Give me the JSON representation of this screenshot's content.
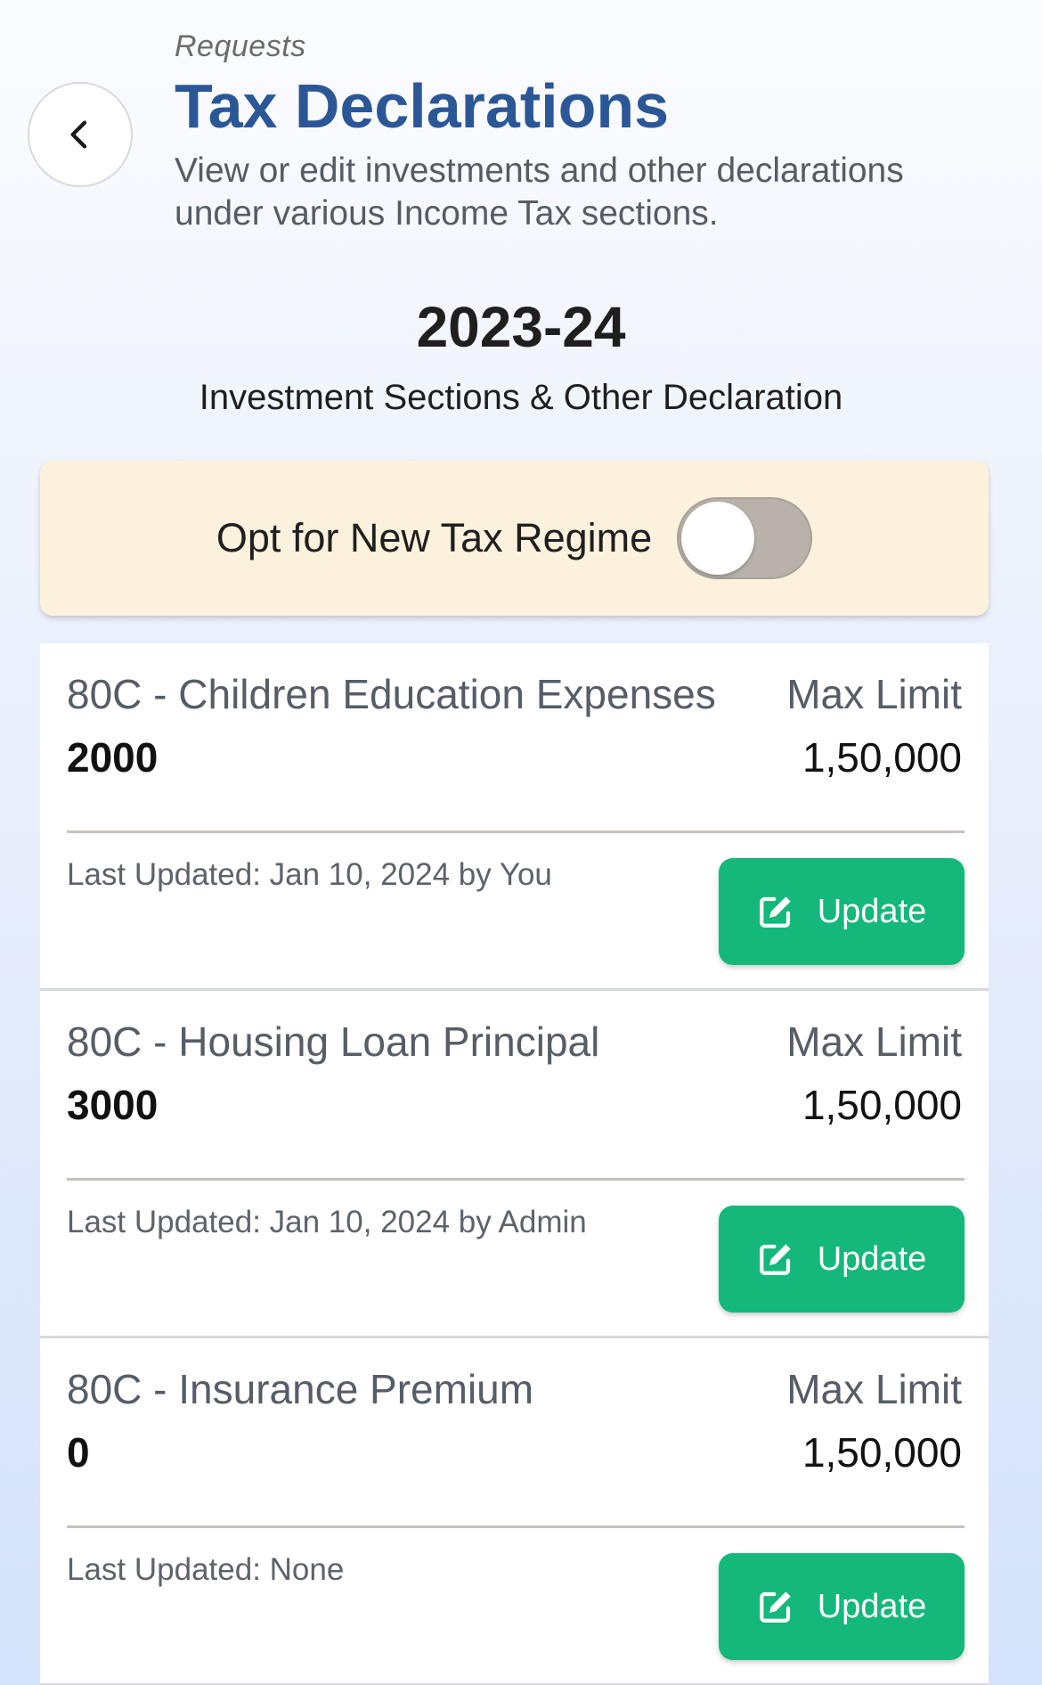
{
  "header": {
    "breadcrumb": "Requests",
    "title": "Tax Declarations",
    "subtitle": "View or edit investments and other declarations under various Income Tax sections."
  },
  "year": {
    "label": "2023-24",
    "subtitle": "Investment Sections & Other Declaration"
  },
  "regime": {
    "label": "Opt for New Tax Regime",
    "enabled": false
  },
  "sections": [
    {
      "title": "80C - Children Education Expenses",
      "value": "2000",
      "limit_label": "Max Limit",
      "limit_value": "1,50,000",
      "updated": "Last Updated: Jan 10, 2024 by You",
      "button_label": "Update"
    },
    {
      "title": "80C - Housing Loan Principal",
      "value": "3000",
      "limit_label": "Max Limit",
      "limit_value": "1,50,000",
      "updated": "Last Updated: Jan 10, 2024 by Admin",
      "button_label": "Update"
    },
    {
      "title": "80C - Insurance Premium",
      "value": "0",
      "limit_label": "Max Limit",
      "limit_value": "1,50,000",
      "updated": "Last Updated: None",
      "button_label": "Update"
    }
  ],
  "colors": {
    "title": "#2c5797",
    "accent_green": "#14b87a",
    "regime_bg": "#fcf1dc",
    "toggle_off": "#b9b2aa"
  },
  "icons": {
    "back": "chevron-left-icon",
    "update": "edit-icon"
  }
}
